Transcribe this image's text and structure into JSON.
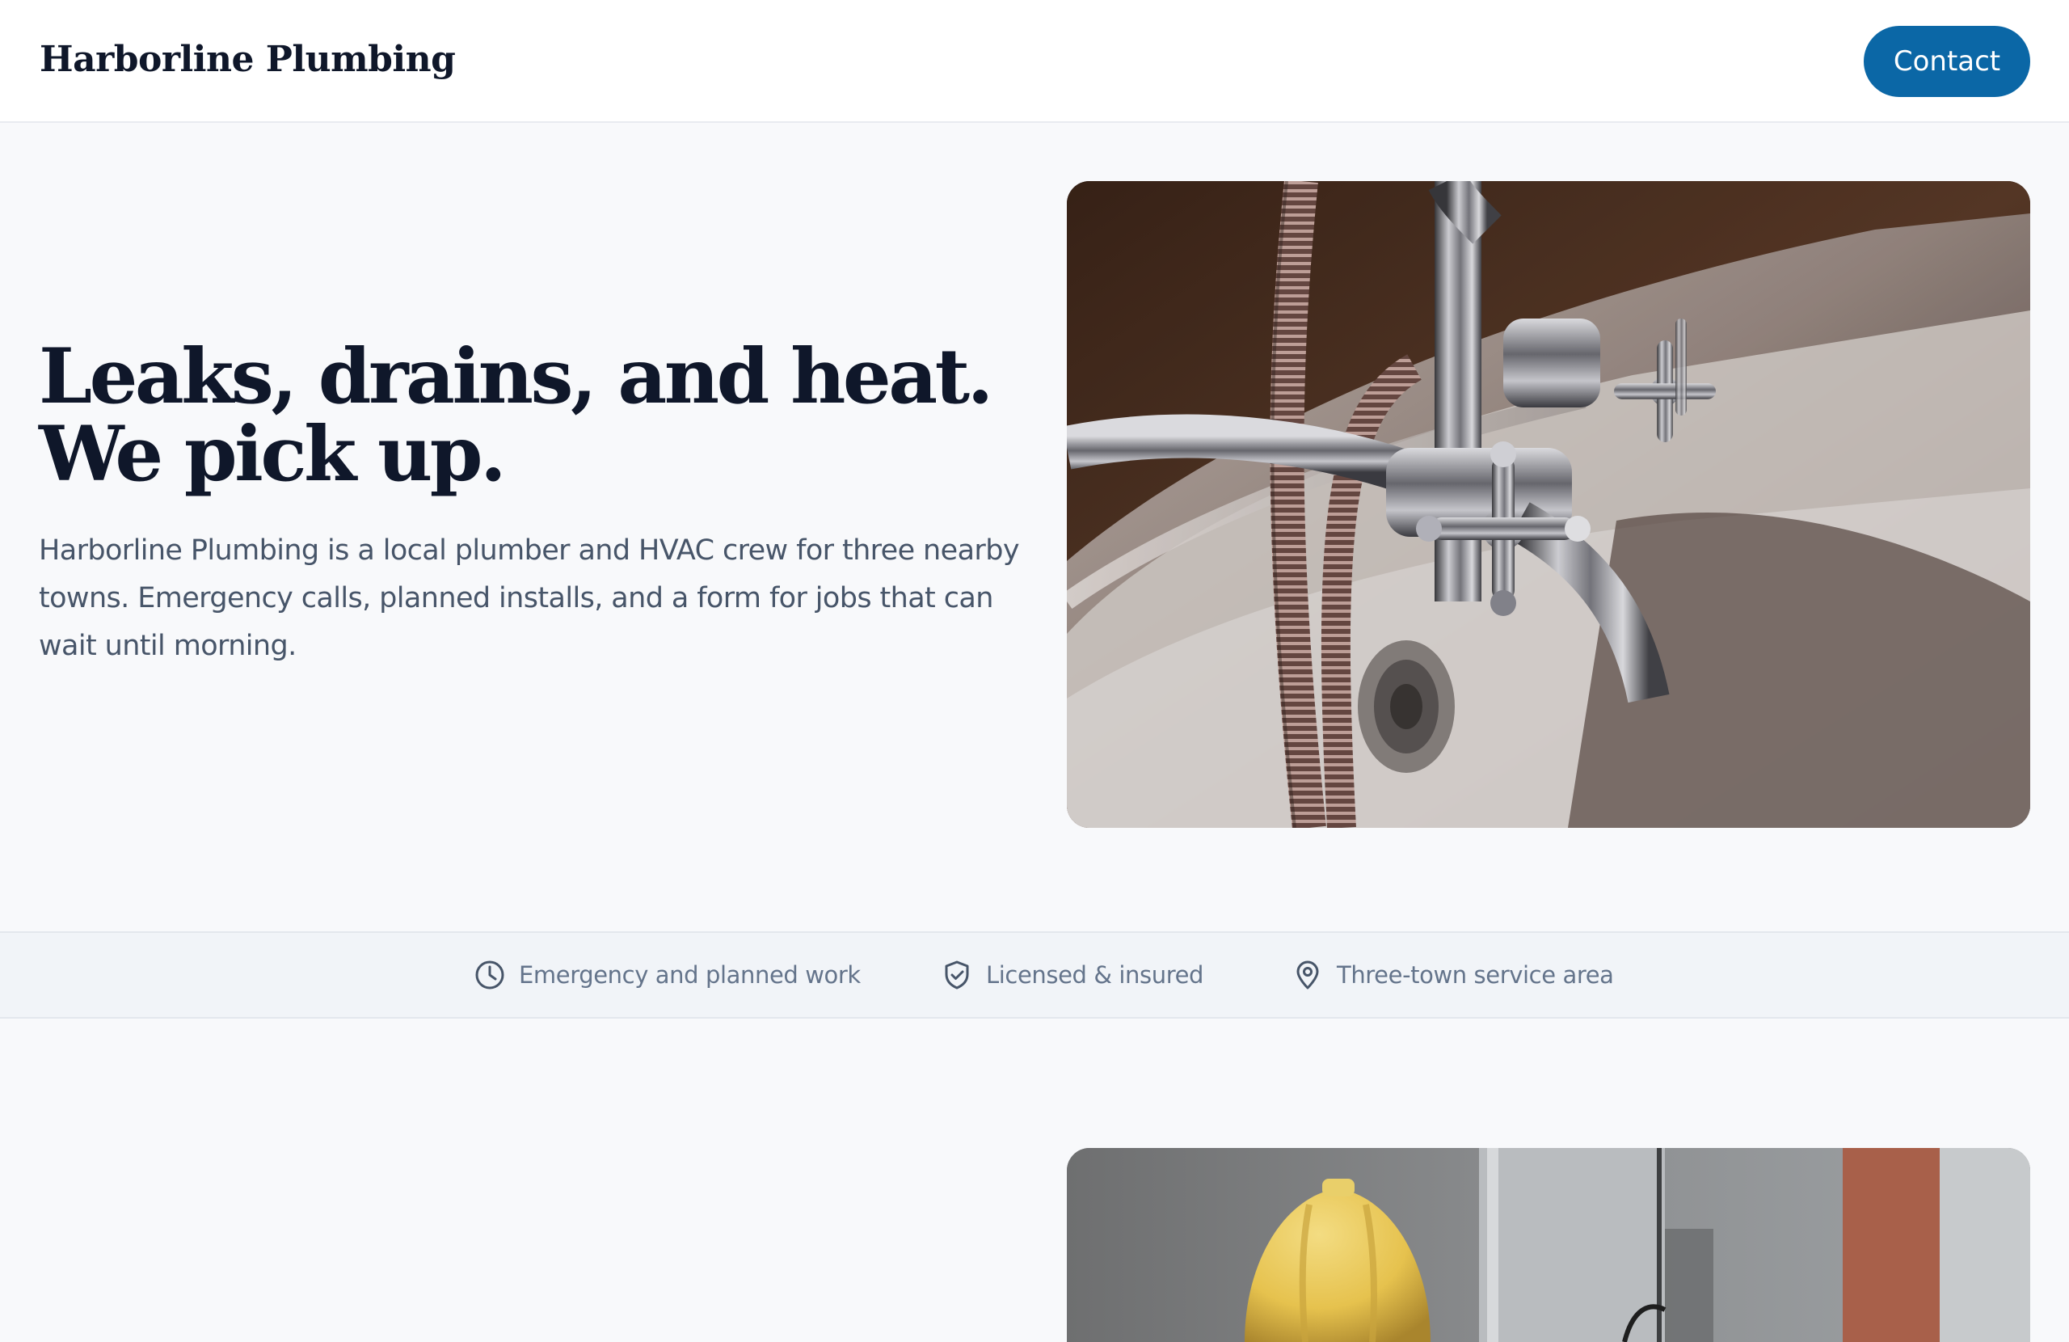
{
  "header": {
    "brand": "Harborline Plumbing",
    "contact_label": "Contact"
  },
  "hero": {
    "title": "Leaks, drains, and heat. We pick up.",
    "lede": "Harborline Plumbing is a local plumber and HVAC crew for three nearby towns. Emergency calls, planned installs, and a form for jobs that can wait until morning.",
    "image_icon": "faucet-photo"
  },
  "trust": {
    "items": [
      {
        "icon": "clock-icon",
        "label": "Emergency and planned work"
      },
      {
        "icon": "shield-check-icon",
        "label": "Licensed & insured"
      },
      {
        "icon": "map-pin-icon",
        "label": "Three-town service area"
      }
    ]
  },
  "next_section": {
    "image_icon": "worker-hardhat-photo"
  },
  "colors": {
    "accent": "#0b67a6",
    "text_dark": "#0f172a",
    "text_muted": "#475569",
    "strip_text": "#64748b",
    "page_bg": "#f8f9fb"
  }
}
